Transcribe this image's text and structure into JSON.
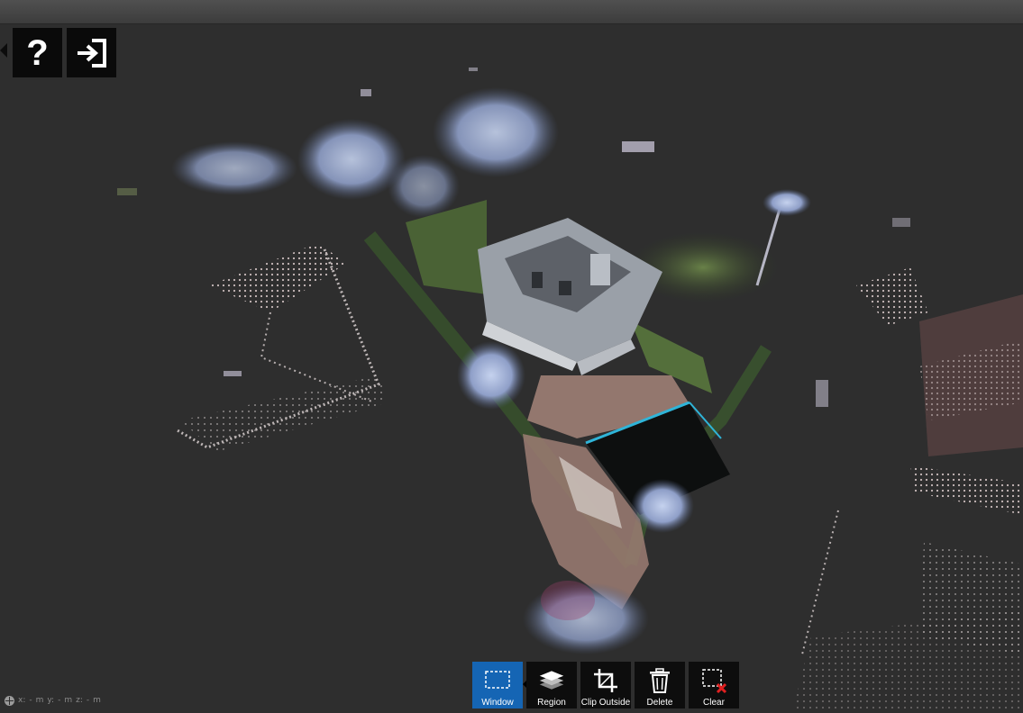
{
  "top_left_tools": {
    "help_icon": "question-mark-icon",
    "help_glyph": "?",
    "exit_icon": "exit-icon"
  },
  "viewport": {
    "content": "point-cloud-scene",
    "background_color": "#2e2e2e"
  },
  "toolbar": {
    "buttons": [
      {
        "label": "Window",
        "icon": "window-select-icon",
        "active": true
      },
      {
        "label": "Region",
        "icon": "layers-icon",
        "active": false
      },
      {
        "label": "Clip Outside",
        "icon": "crop-icon",
        "active": false
      },
      {
        "label": "Delete",
        "icon": "trash-icon",
        "active": false
      },
      {
        "label": "Clear",
        "icon": "clear-selection-icon",
        "active": false
      }
    ],
    "active_color": "#1565b4"
  },
  "coordinates": {
    "x_label": "x:",
    "x_value": "-",
    "x_unit": "m",
    "y_label": "y:",
    "y_value": "-",
    "y_unit": "m",
    "z_label": "z:",
    "z_value": "-",
    "z_unit": "m"
  }
}
